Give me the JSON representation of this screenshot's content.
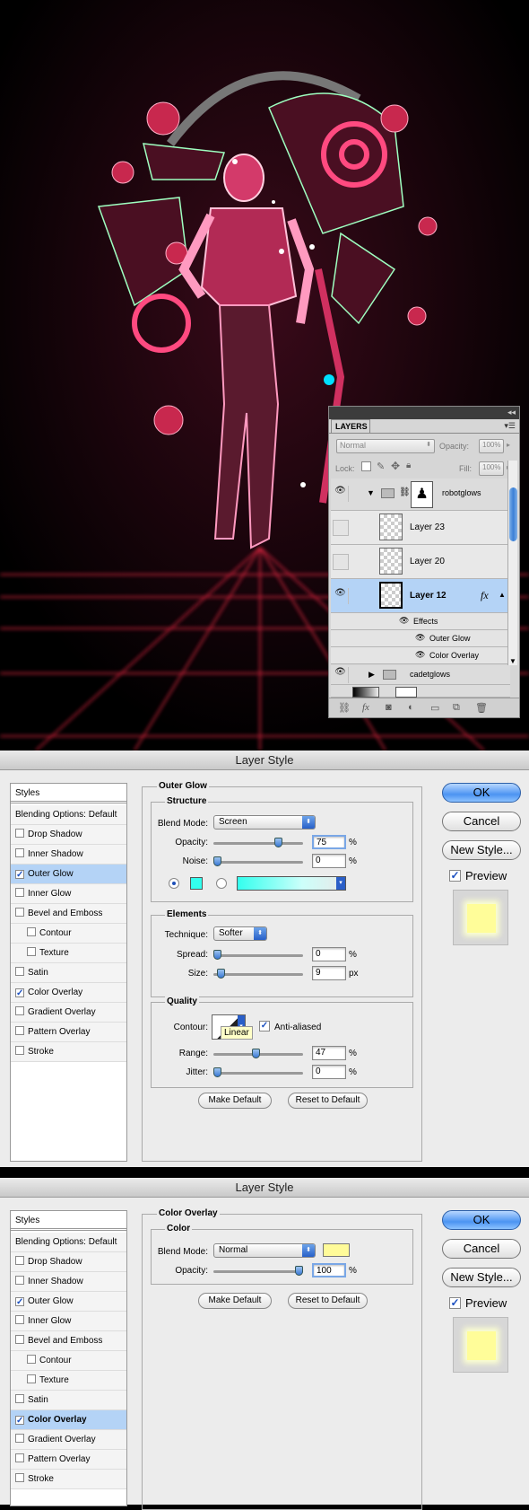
{
  "layers_panel": {
    "tab": "LAYERS",
    "blend_mode": "Normal",
    "opacity_label": "Opacity:",
    "opacity": "100%",
    "lock_label": "Lock:",
    "fill_label": "Fill:",
    "fill": "100%",
    "rows": {
      "group": "robotglows",
      "layer23": "Layer 23",
      "layer20": "Layer 20",
      "layer12": "Layer 12",
      "fx": "fx",
      "effects": "Effects",
      "outer_glow": "Outer Glow",
      "color_overlay": "Color Overlay",
      "group2": "cadetglows"
    }
  },
  "dialog1": {
    "title": "Layer Style",
    "styles": [
      "Styles",
      "Blending Options: Default",
      "Drop Shadow",
      "Inner Shadow",
      "Outer Glow",
      "Inner Glow",
      "Bevel and Emboss",
      "Contour",
      "Texture",
      "Satin",
      "Color Overlay",
      "Gradient Overlay",
      "Pattern Overlay",
      "Stroke"
    ],
    "section": "Outer Glow",
    "structure": {
      "title": "Structure",
      "blend_mode_label": "Blend Mode:",
      "blend_mode": "Screen",
      "opacity_label": "Opacity:",
      "opacity": "75",
      "noise_label": "Noise:",
      "noise": "0",
      "opacity_level": 0.75,
      "noise_level": 0.0
    },
    "elements": {
      "title": "Elements",
      "technique_label": "Technique:",
      "technique": "Softer",
      "spread_label": "Spread:",
      "spread": "0",
      "size_label": "Size:",
      "size": "9",
      "size_unit": "px",
      "spread_level": 0.0,
      "size_level": 0.04
    },
    "quality": {
      "title": "Quality",
      "contour_label": "Contour:",
      "anti_aliased": "Anti-aliased",
      "tooltip": "Linear",
      "range_label": "Range:",
      "range": "47",
      "jitter_label": "Jitter:",
      "jitter": "0",
      "range_level": 0.47,
      "jitter_level": 0.0
    },
    "make_default": "Make Default",
    "reset_default": "Reset to Default",
    "pct": "%",
    "glow_color": "#33ffee"
  },
  "dialog2": {
    "title": "Layer Style",
    "section": "Color Overlay",
    "color": {
      "title": "Color",
      "blend_mode_label": "Blend Mode:",
      "blend_mode": "Normal",
      "opacity_label": "Opacity:",
      "opacity": "100",
      "opacity_level": 1.0
    },
    "make_default": "Make Default",
    "reset_default": "Reset to Default",
    "pct": "%",
    "overlay_color": "#fffb99"
  },
  "side_buttons": {
    "ok": "OK",
    "cancel": "Cancel",
    "new_style": "New Style...",
    "preview": "Preview"
  }
}
